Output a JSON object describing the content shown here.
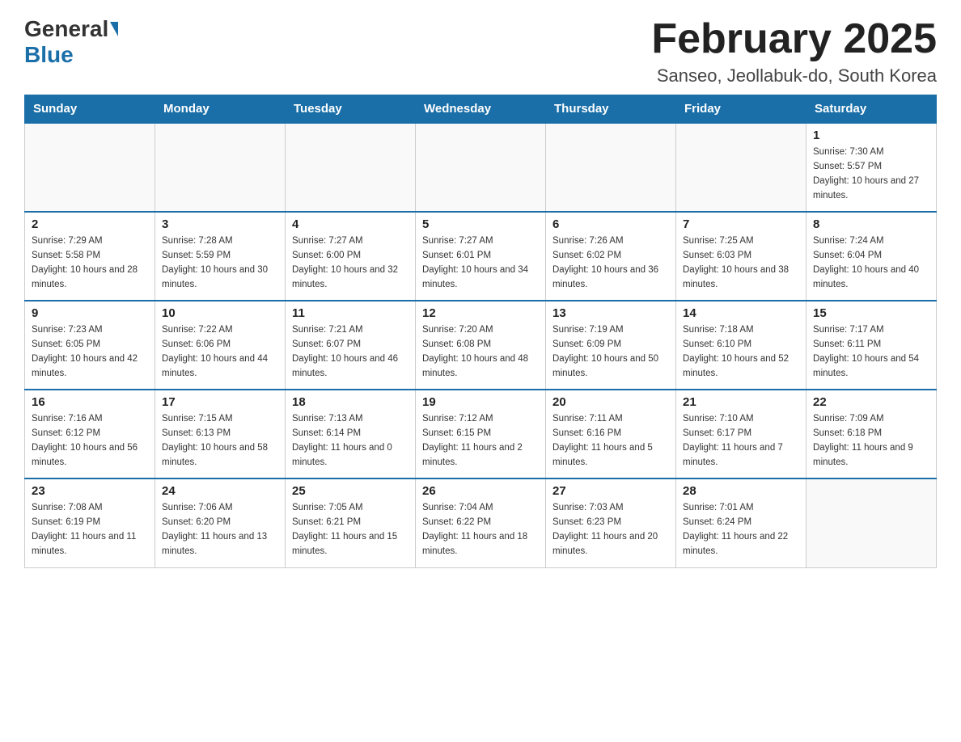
{
  "header": {
    "logo": {
      "general": "General",
      "blue": "Blue"
    },
    "title": "February 2025",
    "location": "Sanseo, Jeollabuk-do, South Korea"
  },
  "days_of_week": [
    "Sunday",
    "Monday",
    "Tuesday",
    "Wednesday",
    "Thursday",
    "Friday",
    "Saturday"
  ],
  "weeks": [
    [
      {
        "day": "",
        "info": ""
      },
      {
        "day": "",
        "info": ""
      },
      {
        "day": "",
        "info": ""
      },
      {
        "day": "",
        "info": ""
      },
      {
        "day": "",
        "info": ""
      },
      {
        "day": "",
        "info": ""
      },
      {
        "day": "1",
        "info": "Sunrise: 7:30 AM\nSunset: 5:57 PM\nDaylight: 10 hours and 27 minutes."
      }
    ],
    [
      {
        "day": "2",
        "info": "Sunrise: 7:29 AM\nSunset: 5:58 PM\nDaylight: 10 hours and 28 minutes."
      },
      {
        "day": "3",
        "info": "Sunrise: 7:28 AM\nSunset: 5:59 PM\nDaylight: 10 hours and 30 minutes."
      },
      {
        "day": "4",
        "info": "Sunrise: 7:27 AM\nSunset: 6:00 PM\nDaylight: 10 hours and 32 minutes."
      },
      {
        "day": "5",
        "info": "Sunrise: 7:27 AM\nSunset: 6:01 PM\nDaylight: 10 hours and 34 minutes."
      },
      {
        "day": "6",
        "info": "Sunrise: 7:26 AM\nSunset: 6:02 PM\nDaylight: 10 hours and 36 minutes."
      },
      {
        "day": "7",
        "info": "Sunrise: 7:25 AM\nSunset: 6:03 PM\nDaylight: 10 hours and 38 minutes."
      },
      {
        "day": "8",
        "info": "Sunrise: 7:24 AM\nSunset: 6:04 PM\nDaylight: 10 hours and 40 minutes."
      }
    ],
    [
      {
        "day": "9",
        "info": "Sunrise: 7:23 AM\nSunset: 6:05 PM\nDaylight: 10 hours and 42 minutes."
      },
      {
        "day": "10",
        "info": "Sunrise: 7:22 AM\nSunset: 6:06 PM\nDaylight: 10 hours and 44 minutes."
      },
      {
        "day": "11",
        "info": "Sunrise: 7:21 AM\nSunset: 6:07 PM\nDaylight: 10 hours and 46 minutes."
      },
      {
        "day": "12",
        "info": "Sunrise: 7:20 AM\nSunset: 6:08 PM\nDaylight: 10 hours and 48 minutes."
      },
      {
        "day": "13",
        "info": "Sunrise: 7:19 AM\nSunset: 6:09 PM\nDaylight: 10 hours and 50 minutes."
      },
      {
        "day": "14",
        "info": "Sunrise: 7:18 AM\nSunset: 6:10 PM\nDaylight: 10 hours and 52 minutes."
      },
      {
        "day": "15",
        "info": "Sunrise: 7:17 AM\nSunset: 6:11 PM\nDaylight: 10 hours and 54 minutes."
      }
    ],
    [
      {
        "day": "16",
        "info": "Sunrise: 7:16 AM\nSunset: 6:12 PM\nDaylight: 10 hours and 56 minutes."
      },
      {
        "day": "17",
        "info": "Sunrise: 7:15 AM\nSunset: 6:13 PM\nDaylight: 10 hours and 58 minutes."
      },
      {
        "day": "18",
        "info": "Sunrise: 7:13 AM\nSunset: 6:14 PM\nDaylight: 11 hours and 0 minutes."
      },
      {
        "day": "19",
        "info": "Sunrise: 7:12 AM\nSunset: 6:15 PM\nDaylight: 11 hours and 2 minutes."
      },
      {
        "day": "20",
        "info": "Sunrise: 7:11 AM\nSunset: 6:16 PM\nDaylight: 11 hours and 5 minutes."
      },
      {
        "day": "21",
        "info": "Sunrise: 7:10 AM\nSunset: 6:17 PM\nDaylight: 11 hours and 7 minutes."
      },
      {
        "day": "22",
        "info": "Sunrise: 7:09 AM\nSunset: 6:18 PM\nDaylight: 11 hours and 9 minutes."
      }
    ],
    [
      {
        "day": "23",
        "info": "Sunrise: 7:08 AM\nSunset: 6:19 PM\nDaylight: 11 hours and 11 minutes."
      },
      {
        "day": "24",
        "info": "Sunrise: 7:06 AM\nSunset: 6:20 PM\nDaylight: 11 hours and 13 minutes."
      },
      {
        "day": "25",
        "info": "Sunrise: 7:05 AM\nSunset: 6:21 PM\nDaylight: 11 hours and 15 minutes."
      },
      {
        "day": "26",
        "info": "Sunrise: 7:04 AM\nSunset: 6:22 PM\nDaylight: 11 hours and 18 minutes."
      },
      {
        "day": "27",
        "info": "Sunrise: 7:03 AM\nSunset: 6:23 PM\nDaylight: 11 hours and 20 minutes."
      },
      {
        "day": "28",
        "info": "Sunrise: 7:01 AM\nSunset: 6:24 PM\nDaylight: 11 hours and 22 minutes."
      },
      {
        "day": "",
        "info": ""
      }
    ]
  ]
}
